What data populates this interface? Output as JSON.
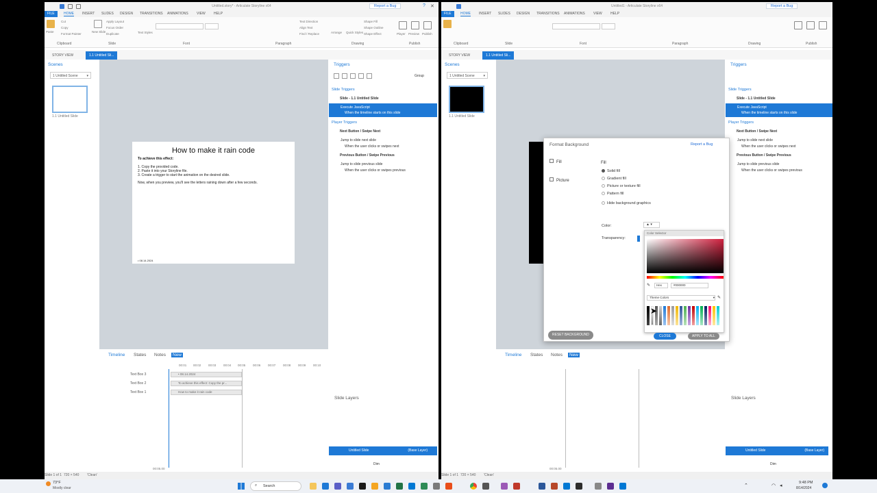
{
  "left_window": {
    "title": "Untitled.story* - Articulate Storyline x64",
    "report": "Report a Bug",
    "menu": [
      "FILE",
      "HOME",
      "INSERT",
      "SLIDES",
      "DESIGN",
      "TRANSITIONS",
      "ANIMATIONS",
      "VIEW",
      "HELP"
    ],
    "ribbon_groups": [
      "Clipboard",
      "Slide",
      "Font",
      "Paragraph",
      "Drawing",
      "Publish"
    ],
    "ribbon_small": [
      "Paste",
      "Cut",
      "Copy",
      "Format Painter",
      "New Slide",
      "Apply Layout",
      "Focus Order",
      "Duplicate",
      "Text Styles",
      "Text Direction",
      "Align Text",
      "Find / Replace",
      "Arrange",
      "Quick Styles",
      "Shape Fill",
      "Shape Outline",
      "Shape Effect",
      "Player",
      "Preview",
      "Publish"
    ],
    "tabs": [
      "STORY VIEW",
      "1.1 Untitled Sli..."
    ],
    "scenes_title": "Scenes",
    "scene_select": "1 Untitled Scene",
    "thumb_label": "1.1 Untitled Slide",
    "slide": {
      "title": "How to make it rain code",
      "subtitle": "To achieve this effect:",
      "steps": [
        "1.  Copy the provided code.",
        "2.  Paste it into your Storyline file.",
        "3.  Create a trigger to start the animation on the desired slide."
      ],
      "note": "Now, when you preview, you'll see the letters raining down after a few seconds.",
      "date": "• 08.14.2024"
    },
    "triggers": {
      "title": "Triggers",
      "group": "Group",
      "slide_triggers": "Slide Triggers",
      "slide_head": "Slide - 1.1 Untitled Slide",
      "exec": "Execute JavaScript",
      "exec_when": "When the timeline starts on this slide",
      "player_triggers": "Player Triggers",
      "next_head": "Next Button / Swipe Next",
      "next_action": "Jump to slide next slide",
      "next_when": "When the user clicks or swipes next",
      "prev_head": "Previous Button / Swipe Previous",
      "prev_action": "Jump to slide previous slide",
      "prev_when": "When the user clicks or swipes previous"
    },
    "timeline": {
      "tabs": [
        "Timeline",
        "States",
        "Notes",
        "New"
      ],
      "ticks": [
        "00:01",
        "00:02",
        "00:03",
        "00:04",
        "00:05",
        "00:06",
        "00:07",
        "00:08",
        "00:09",
        "00:10"
      ],
      "rows": [
        {
          "name": "Text Box 3",
          "bar": "• 08.14.2024"
        },
        {
          "name": "Text Box 2",
          "bar": "To achieve this effect: Copy the pr..."
        },
        {
          "name": "Text Box 1",
          "bar": "How to make it rain code"
        }
      ],
      "end": "00:05.00"
    },
    "slide_layers": "Slide Layers",
    "layer_name": "Untitled Slide",
    "layer_base": "(Base Layer)",
    "dim": "Dim",
    "status": [
      "Slide 1 of 1",
      "720 × 540",
      "'Clean'"
    ]
  },
  "right_window": {
    "title": "Untitled1 - Articulate Storyline x64",
    "report": "Report a Bug",
    "tabs": [
      "STORY VIEW",
      "1.1 Untitled Sli..."
    ],
    "scenes_title": "Scenes",
    "scene_select": "1 Untitled Scene",
    "thumb_label": "1.1 Untitled Slide",
    "dialog": {
      "title": "Format Background",
      "report": "Report a Bug",
      "nav": [
        "Fill",
        "Picture"
      ],
      "fill_title": "Fill",
      "options": [
        "Solid fill",
        "Gradient fill",
        "Picture or texture fill",
        "Pattern fill",
        "Hide background graphics"
      ],
      "color_label": "Color:",
      "transparency_label": "Transparency:",
      "color_selector": "Color Selector",
      "hex_mode": "Hex",
      "hex_value": "#000000",
      "theme_colors": "Theme Colors",
      "reset": "RESET BACKGROUND",
      "close": "CLOSE",
      "apply": "APPLY TO ALL"
    },
    "timeline_end": "00:05.00",
    "layer_name": "Untitled Slide",
    "layer_base": "(Base Layer)",
    "dim": "Dim",
    "status": [
      "Slide 1 of 1",
      "720 × 540",
      "'Clean'"
    ]
  },
  "taskbar": {
    "weather_temp": "73°F",
    "weather_desc": "Mostly clear",
    "search": "Search",
    "time": "9:48 PM",
    "date": "8/14/2024"
  },
  "colors": {
    "accent": "#1e79d6",
    "canvas": "#ced4da",
    "slide_black": "#000000"
  }
}
